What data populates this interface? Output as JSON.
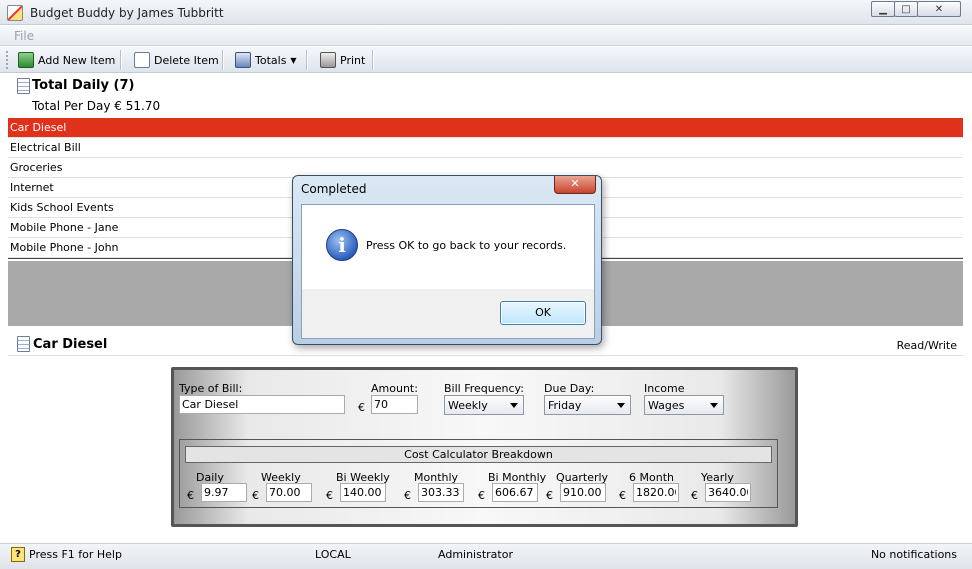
{
  "window": {
    "title": "Budget Buddy by James Tubbritt",
    "min": "▁",
    "max": "□",
    "close": "✕"
  },
  "menu": {
    "file": "File"
  },
  "toolbar": {
    "add": "Add New Item",
    "delete": "Delete Item",
    "totals": "Totals",
    "print": "Print"
  },
  "summary": {
    "title": "Total Daily (7)",
    "per_day": "Total Per Day € 51.70"
  },
  "items": [
    "Car Diesel",
    "Electrical Bill",
    "Groceries",
    "Internet",
    "Kids School Events",
    "Mobile Phone - Jane",
    "Mobile Phone - John"
  ],
  "selected_index": 0,
  "detail": {
    "title": "Car Diesel",
    "mode": "Read/Write",
    "type_label": "Type of Bill:",
    "type_value": "Car Diesel",
    "amount_label": "Amount:",
    "amount_value": "70",
    "currency": "€",
    "freq_label": "Bill Frequency:",
    "freq_value": "Weekly",
    "due_label": "Due Day:",
    "due_value": "Friday",
    "income_label": "Income",
    "income_value": "Wages",
    "breakdown_title": "Cost Calculator Breakdown",
    "breakdown": [
      {
        "label": "Daily",
        "value": "9.97"
      },
      {
        "label": "Weekly",
        "value": "70.00"
      },
      {
        "label": "Bi Weekly",
        "value": "140.00"
      },
      {
        "label": "Monthly",
        "value": "303.33"
      },
      {
        "label": "Bi Monthly",
        "value": "606.67"
      },
      {
        "label": "Quarterly",
        "value": "910.00"
      },
      {
        "label": "6 Month",
        "value": "1820.00"
      },
      {
        "label": "Yearly",
        "value": "3640.00"
      }
    ]
  },
  "status": {
    "help": "Press F1 for Help",
    "location": "LOCAL",
    "user": "Administrator",
    "notifications": "No notifications"
  },
  "dialog": {
    "title": "Completed",
    "close": "✕",
    "message": "Press OK to go back to your records.",
    "ok": "OK"
  },
  "colors": {
    "selected_row": "#e0321a",
    "empty_area": "#a9a9a9"
  }
}
